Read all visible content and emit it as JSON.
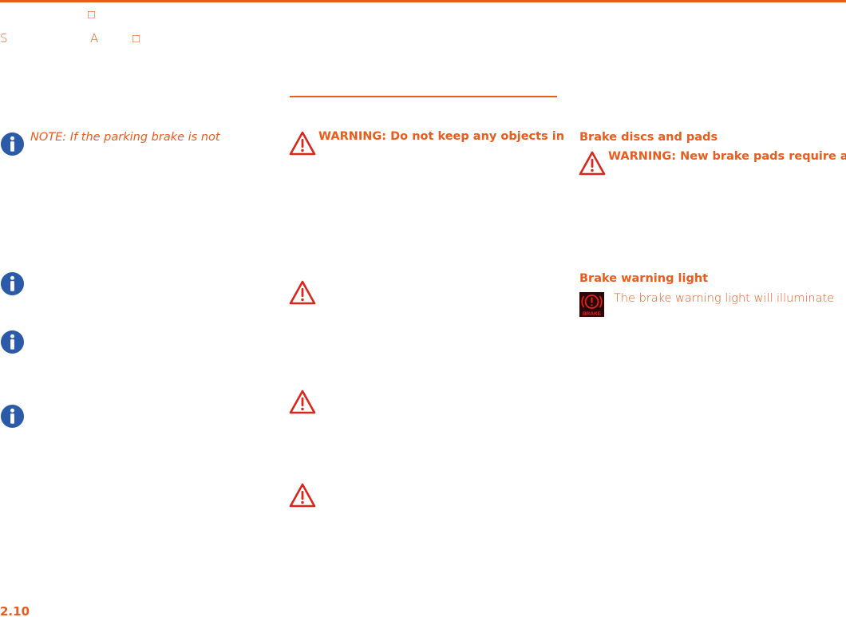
{
  "header": {
    "line1": "□",
    "line2_a": "S",
    "line2_b": "A",
    "line2_c": "□"
  },
  "left_column": {
    "note_text": "NOTE: If the parking brake is not"
  },
  "middle_column": {
    "warning_text": "WARNING: Do not keep any objects in"
  },
  "right_column": {
    "section1_heading": "Brake discs and pads",
    "section1_warning": "WARNING: New brake pads require a",
    "section2_heading": "Brake warning light",
    "section2_text": "The brake warning light will illuminate",
    "brake_icon_label": "BRAKE"
  },
  "footer": {
    "page_number": "2.10"
  },
  "colors": {
    "accent": "#ea5b1c",
    "info_icon": "#2a5aa8",
    "warning_icon": "#d9261c"
  },
  "icons": {
    "info": "info-icon",
    "warning": "warning-triangle-icon",
    "brake": "brake-warning-light-icon"
  }
}
